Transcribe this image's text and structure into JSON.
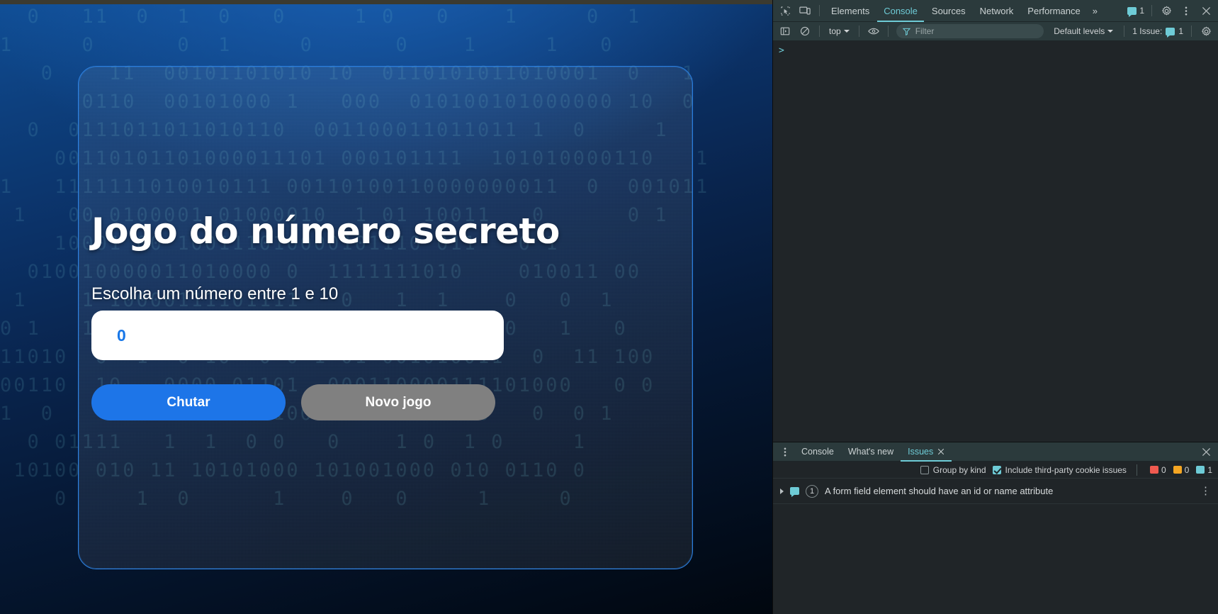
{
  "page": {
    "title": "Jogo do número secreto",
    "subtitle": "Escolha um número entre 1 e 10",
    "input_value": "0",
    "input_placeholder": "0",
    "buttons": {
      "guess": "Chutar",
      "new_game": "Novo jogo"
    },
    "colors": {
      "accent_blue": "#1d75e8",
      "secondary_gray": "#808080",
      "card_border": "#2a7fe0",
      "input_text": "#1877e8"
    },
    "binary_rows": [
      "  0   11  0  1  0   0     1 0   0    1     0  1",
      "1     0      0  1     0      0    1     1   0",
      "   0    11  00101101010 10  0110101011010001  0   1",
      "      0110  00101000 1   000  010100101000000 10  0",
      "  0  0111011011010110  001100011011011 1  0     1",
      "    00110101101000011101 000101111  101010000110   1",
      "1   1111111010010111 00110100110000000011  0  001011",
      " 1   00 0100001 01000010  1 01 10011   0      0 1",
      "    10001 00 100111010000101110 011   0 1",
      "  010010000011010000 0  1111111010    010011 00",
      " 1    1 10000111101111   0   1  1    0   0  1",
      "0 1   111111 01000  0  1    0 1   10 0   1   0",
      "11010  0  1  0 10  0 0 1 01 001010011  0  11 100",
      "00110  10   0000 01101  000110000111101000   0 0",
      "1  0     0011 0011011001011000010 00   0  0 1",
      "  0 01111   1  1  0 0   0    1 0  1 0     1",
      " 10100 010 11 10101000 101001000 010 0110 0",
      "    0     1  0      1    0   0     1     0"
    ]
  },
  "devtools": {
    "toolbar": {
      "icons": [
        "inspect-icon",
        "device-toolbar-icon"
      ],
      "tabs": [
        {
          "label": "Elements",
          "active": false
        },
        {
          "label": "Console",
          "active": true
        },
        {
          "label": "Sources",
          "active": false
        },
        {
          "label": "Network",
          "active": false
        },
        {
          "label": "Performance",
          "active": false
        }
      ],
      "more_tabs": "»",
      "message_count": "1",
      "settings_icon": "gear-icon",
      "more_icon": "kebab-icon",
      "close_icon": "close-icon"
    },
    "console_toolbar": {
      "sidebar_toggle": "sidebar-toggle-icon",
      "clear_label": "clear-console-icon",
      "context": "top",
      "eye_icon": "live-expression-icon",
      "filter_placeholder": "Filter",
      "levels": "Default levels",
      "issues_label": "1 Issue:",
      "issues_count": "1",
      "settings_icon": "gear-icon"
    },
    "console": {
      "prompt": ">"
    },
    "drawer": {
      "menu_icon": "kebab-icon",
      "tabs": [
        {
          "label": "Console",
          "active": false,
          "closable": false
        },
        {
          "label": "What's new",
          "active": false,
          "closable": false
        },
        {
          "label": "Issues",
          "active": true,
          "closable": true
        }
      ],
      "close_icon": "close-icon",
      "filters": {
        "group_by_kind": {
          "label": "Group by kind",
          "checked": false
        },
        "third_party": {
          "label": "Include third-party cookie issues",
          "checked": true
        }
      },
      "badges": {
        "errors": "0",
        "warnings": "0",
        "info": "1"
      },
      "issues": [
        {
          "text": "A form field element should have an id or name attribute",
          "count": "1"
        }
      ]
    }
  }
}
